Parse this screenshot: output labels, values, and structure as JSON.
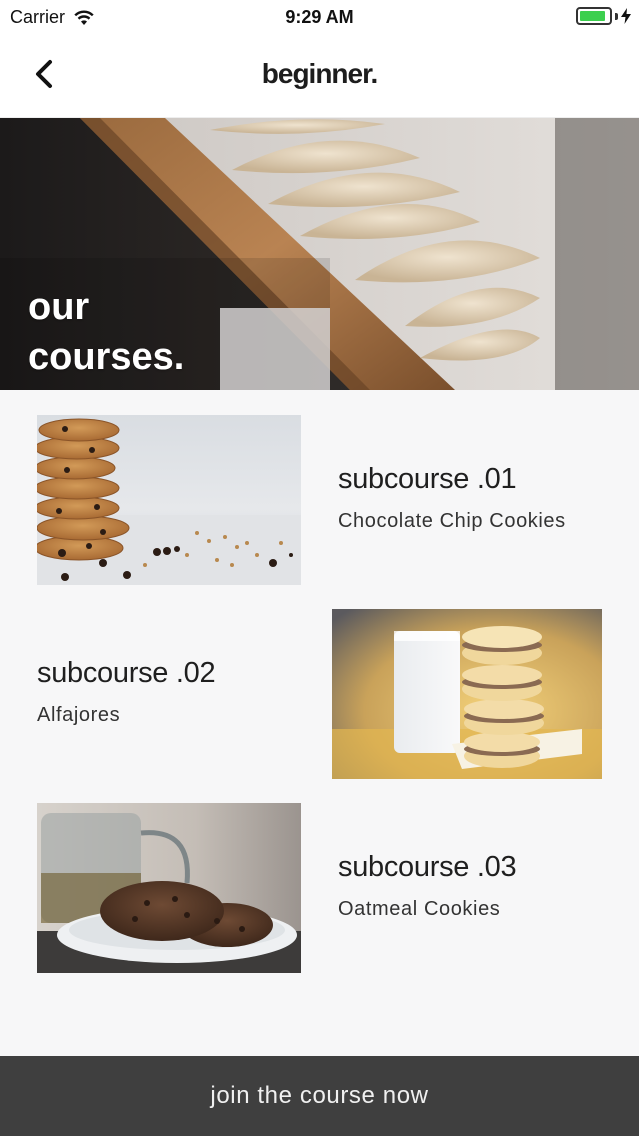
{
  "status_bar": {
    "carrier": "Carrier",
    "time": "9:29 AM",
    "battery_level": 0.9,
    "wifi_icon": "wifi-icon",
    "charging_icon": "bolt-icon"
  },
  "nav": {
    "title": "beginner.",
    "back_icon": "chevron-left-icon"
  },
  "hero": {
    "title_line1": "our",
    "title_line2": "courses."
  },
  "courses": [
    {
      "heading": "subcourse .01",
      "name": "Chocolate Chip Cookies"
    },
    {
      "heading": "subcourse .02",
      "name": "Alfajores"
    },
    {
      "heading": "subcourse .03",
      "name": "Oatmeal Cookies"
    }
  ],
  "cta": {
    "label": "join the course now"
  },
  "colors": {
    "cta_background": "#3f3f3f",
    "battery_green": "#3ccf4e",
    "page_background": "#f7f7f8"
  }
}
